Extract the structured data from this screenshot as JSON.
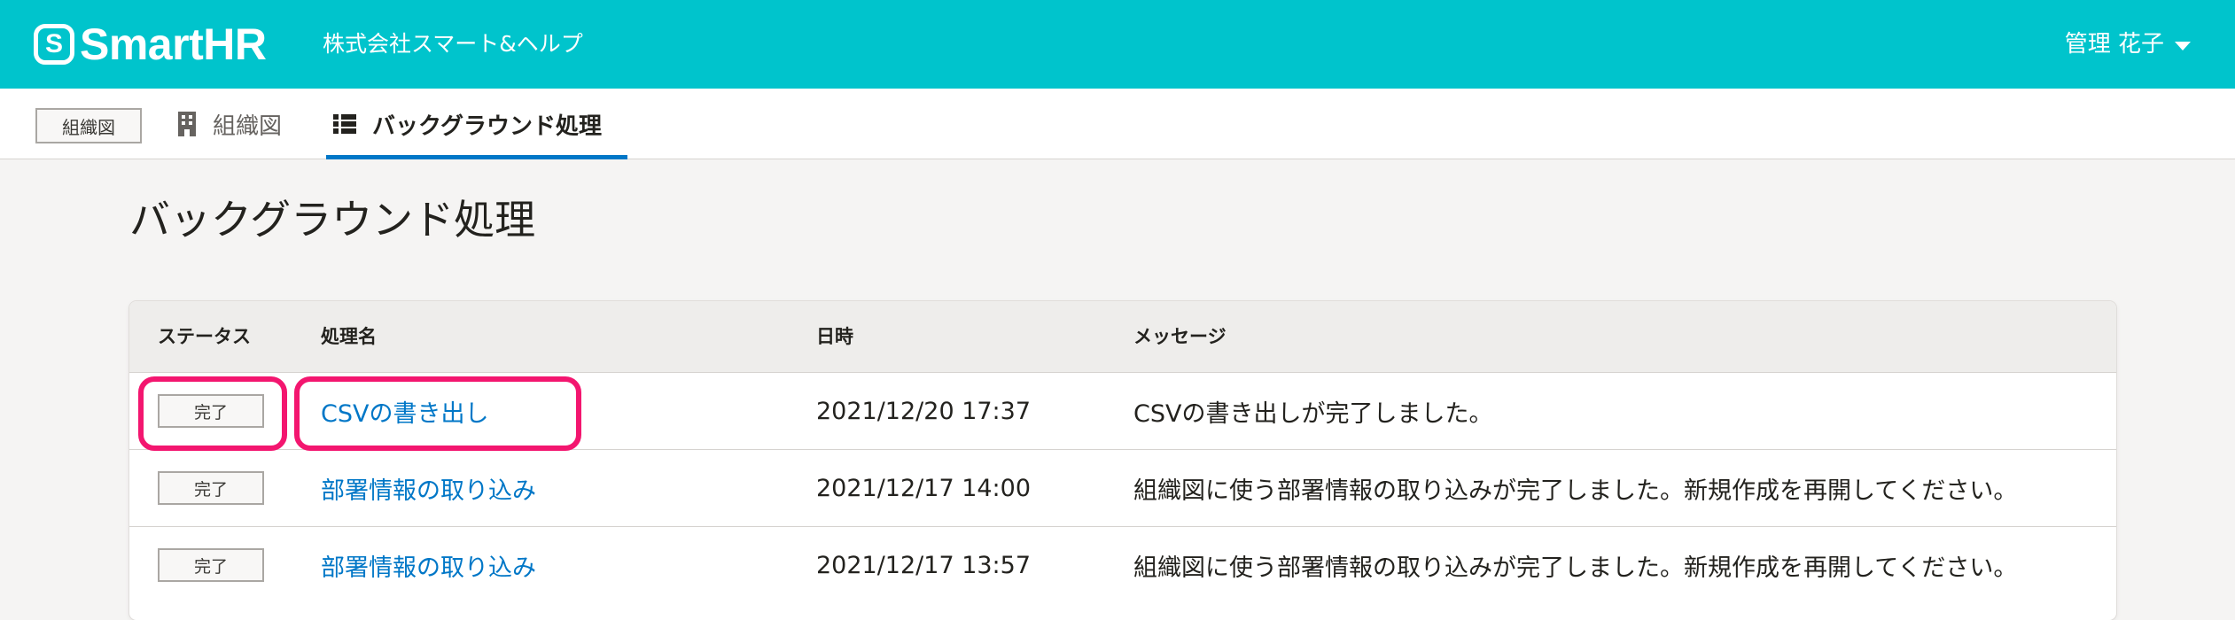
{
  "header": {
    "logo_mark": "S",
    "logo_text": "SmartHR",
    "company": "株式会社スマート&ヘルプ",
    "user_name": "管理 花子"
  },
  "subnav": {
    "tag_label": "組織図",
    "tabs": [
      {
        "label": "組織図",
        "icon": "building-icon",
        "active": false
      },
      {
        "label": "バックグラウンド処理",
        "icon": "list-icon",
        "active": true
      }
    ]
  },
  "page": {
    "title": "バックグラウンド処理"
  },
  "table": {
    "columns": {
      "status": "ステータス",
      "name": "処理名",
      "date": "日時",
      "message": "メッセージ"
    },
    "rows": [
      {
        "status": "完了",
        "name": "CSVの書き出し",
        "date": "2021/12/20 17:37",
        "message": "CSVの書き出しが完了しました。"
      },
      {
        "status": "完了",
        "name": "部署情報の取り込み",
        "date": "2021/12/17 14:00",
        "message": "組織図に使う部署情報の取り込みが完了しました。新規作成を再開してください。"
      },
      {
        "status": "完了",
        "name": "部署情報の取り込み",
        "date": "2021/12/17 13:57",
        "message": "組織図に使う部署情報の取り込みが完了しました。新規作成を再開してください。"
      }
    ]
  },
  "colors": {
    "header_bg": "#00c4cc",
    "link": "#0077c7",
    "active_tab_underline": "#0077c7",
    "highlight": "#f3166f"
  }
}
